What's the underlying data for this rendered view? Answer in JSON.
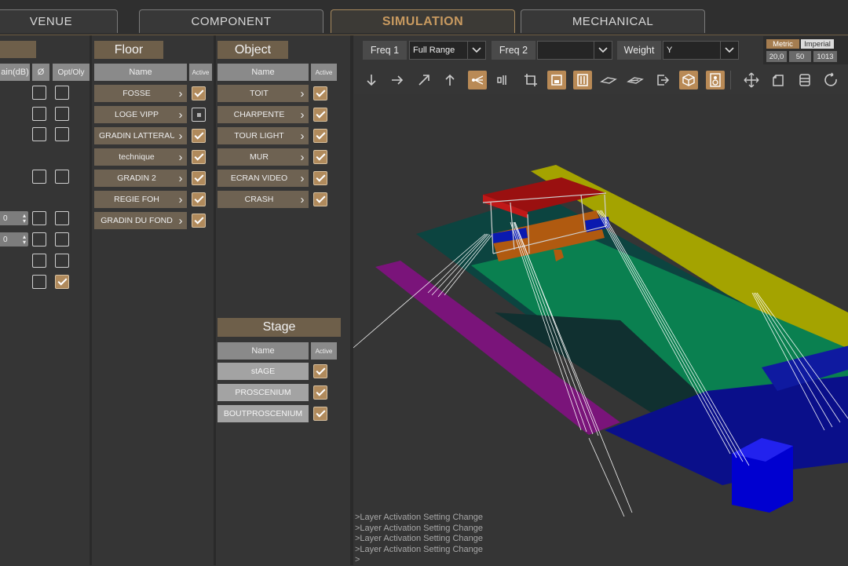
{
  "tabs": [
    {
      "label": "VENUE",
      "active": false
    },
    {
      "label": "COMPONENT",
      "active": false
    },
    {
      "label": "SIMULATION",
      "active": true
    },
    {
      "label": "MECHANICAL",
      "active": false
    }
  ],
  "left_panel": {
    "col_headers": [
      "ain(dB)",
      "Ø",
      "Opt/Oly"
    ],
    "spin_values": [
      "0",
      "0"
    ]
  },
  "floor": {
    "title": "Floor",
    "col_name": "Name",
    "col_active": "Active",
    "rows": [
      {
        "name": "FOSSE",
        "state": "on"
      },
      {
        "name": "LOGE VIPP",
        "state": "partial"
      },
      {
        "name": "GRADIN LATTERAUX",
        "state": "on"
      },
      {
        "name": "technique",
        "state": "on"
      },
      {
        "name": "GRADIN 2",
        "state": "on"
      },
      {
        "name": "REGIE FOH",
        "state": "on"
      },
      {
        "name": "GRADIN DU FOND",
        "state": "on"
      }
    ]
  },
  "object": {
    "title": "Object",
    "col_name": "Name",
    "col_active": "Active",
    "rows": [
      {
        "name": "TOIT",
        "state": "on"
      },
      {
        "name": "CHARPENTE",
        "state": "on"
      },
      {
        "name": "TOUR LIGHT",
        "state": "on"
      },
      {
        "name": "MUR",
        "state": "on"
      },
      {
        "name": "ECRAN VIDEO",
        "state": "on"
      },
      {
        "name": "CRASH",
        "state": "on"
      }
    ]
  },
  "stage": {
    "title": "Stage",
    "col_name": "Name",
    "col_active": "Active",
    "rows": [
      {
        "name": "stAGE",
        "state": "on"
      },
      {
        "name": "PROSCENIUM",
        "state": "on"
      },
      {
        "name": "BOUTPROSCENIUM",
        "state": "on"
      }
    ]
  },
  "toolbar": {
    "freq1_label": "Freq 1",
    "freq1_value": "Full Range",
    "freq2_label": "Freq 2",
    "freq2_value": "",
    "weight_label": "Weight",
    "weight_value": "Y",
    "unit_metric": "Metric",
    "unit_imperial": "Imperial",
    "temp": "20,0",
    "humidity": "50",
    "pressure": "1013"
  },
  "log_lines": [
    ">Layer Activation Setting Change",
    ">Layer Activation Setting Change",
    ">Layer Activation Setting Change",
    ">Layer Activation Setting Change",
    ">"
  ],
  "colors": {
    "accent": "#b98a56",
    "tab_active_text": "#c89a60"
  }
}
